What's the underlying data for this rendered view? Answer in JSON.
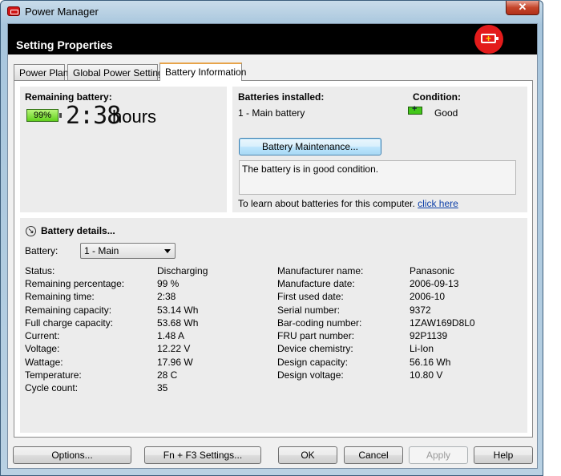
{
  "window": {
    "title": "Power Manager",
    "close": "✕"
  },
  "header": {
    "title": "Setting Properties",
    "badge_icon": "battery-plus-icon",
    "accent": "#e31b1b"
  },
  "tabs": [
    {
      "label": "Power Plan"
    },
    {
      "label": "Global Power Settings"
    },
    {
      "label": "Battery Information"
    }
  ],
  "remaining": {
    "label": "Remaining battery:",
    "percent": "99%",
    "time": "2:38",
    "unit": "hours"
  },
  "installed": {
    "label": "Batteries installed:",
    "value": "1 - Main battery",
    "condition_label": "Condition:",
    "condition_value": "Good",
    "maintenance_button": "Battery Maintenance...",
    "message": "The battery is in good condition.",
    "learn_text": "To learn about batteries for this computer.",
    "learn_link": "click here"
  },
  "details": {
    "title": "Battery details...",
    "battery_label": "Battery:",
    "battery_selected": "1 - Main",
    "left": [
      {
        "k": "Status:",
        "v": "Discharging"
      },
      {
        "k": "Remaining percentage:",
        "v": "99 %"
      },
      {
        "k": "Remaining time:",
        "v": "2:38"
      },
      {
        "k": "Remaining capacity:",
        "v": "53.14 Wh"
      },
      {
        "k": "Full charge capacity:",
        "v": "53.68 Wh"
      },
      {
        "k": "Current:",
        "v": "1.48 A"
      },
      {
        "k": "Voltage:",
        "v": "12.22 V"
      },
      {
        "k": "Wattage:",
        "v": "17.96 W"
      },
      {
        "k": "Temperature:",
        "v": "28 C"
      },
      {
        "k": "Cycle count:",
        "v": "35"
      }
    ],
    "right": [
      {
        "k": "Manufacturer name:",
        "v": "Panasonic"
      },
      {
        "k": "Manufacture date:",
        "v": "2006-09-13"
      },
      {
        "k": "First used date:",
        "v": "2006-10"
      },
      {
        "k": "Serial number:",
        "v": "9372"
      },
      {
        "k": "Bar-coding number:",
        "v": "1ZAW169D8L0"
      },
      {
        "k": "FRU part number:",
        "v": "92P1139"
      },
      {
        "k": "Device chemistry:",
        "v": "Li-Ion"
      },
      {
        "k": "Design capacity:",
        "v": "56.16 Wh"
      },
      {
        "k": "Design voltage:",
        "v": "10.80 V"
      }
    ]
  },
  "footer": {
    "options": "Options...",
    "fn_f3": "Fn + F3 Settings...",
    "ok": "OK",
    "cancel": "Cancel",
    "apply": "Apply",
    "help": "Help"
  }
}
